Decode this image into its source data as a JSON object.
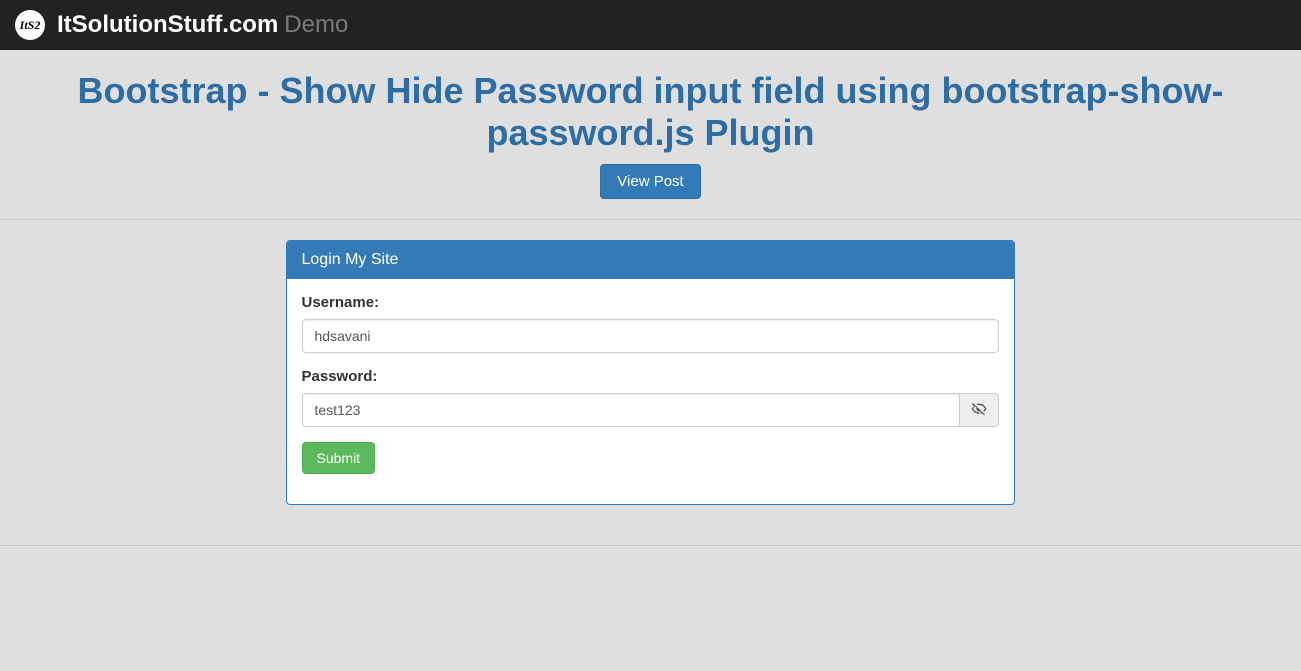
{
  "navbar": {
    "logo_text": "ItS2",
    "brand_main": "ItSolutionStuff.com",
    "brand_sub": "Demo"
  },
  "heading": "Bootstrap - Show Hide Password input field using bootstrap-show-password.js Plugin",
  "view_post_label": "View Post",
  "panel": {
    "title": "Login My Site",
    "username_label": "Username:",
    "username_value": "hdsavani",
    "password_label": "Password:",
    "password_value": "test123",
    "submit_label": "Submit"
  }
}
